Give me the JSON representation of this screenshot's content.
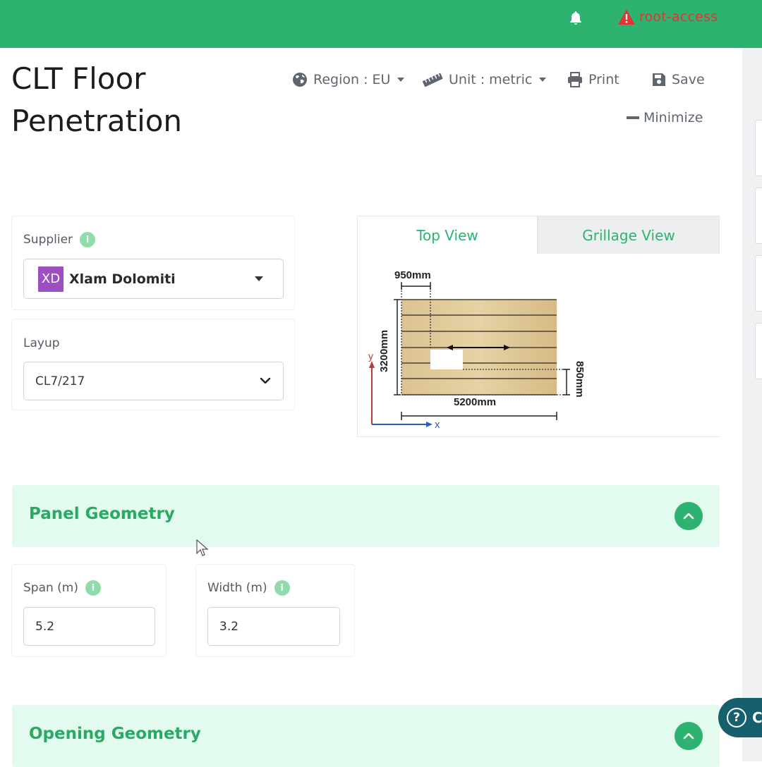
{
  "header": {
    "alert_label": "root-access"
  },
  "page": {
    "title_line1": "CLT Floor",
    "title_line2": "Penetration"
  },
  "toolbar": {
    "region_label": "Region : EU",
    "unit_label": "Unit : metric",
    "print_label": "Print",
    "save_label": "Save",
    "minimize_label": "Minimize"
  },
  "supplier": {
    "label": "Supplier",
    "info": "i",
    "badge": "XD",
    "value": "Xlam Dolomiti"
  },
  "layup": {
    "label": "Layup",
    "value": "CL7/217"
  },
  "view_tabs": [
    {
      "label": "Top View",
      "active": true
    },
    {
      "label": "Grillage View",
      "active": false
    }
  ],
  "diagram": {
    "dim_top": "950mm",
    "dim_left": "3200mm",
    "dim_right": "850mm",
    "dim_bottom": "5200mm",
    "axis_y": "y",
    "axis_x": "x"
  },
  "panel_geometry": {
    "title": "Panel Geometry",
    "span_label": "Span (m)",
    "span_value": "5.2",
    "width_label": "Width (m)",
    "width_value": "3.2",
    "info": "i"
  },
  "opening_geometry": {
    "title": "Opening Geometry"
  },
  "help": {
    "label": "C"
  },
  "colors": {
    "brand_green": "#2db36f",
    "alert_red": "#e03535",
    "section_bg": "#e3fbef",
    "help_teal": "#15606c"
  }
}
